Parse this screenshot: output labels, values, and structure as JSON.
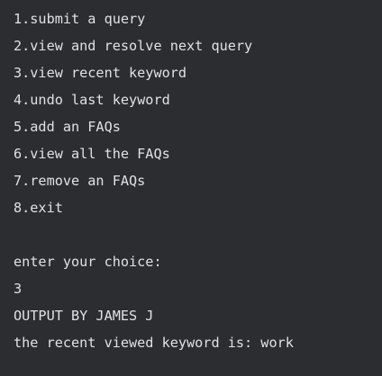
{
  "console": {
    "menu": [
      "1.submit a query",
      "2.view and resolve next query",
      "3.view recent keyword",
      "4.undo last keyword",
      "5.add an FAQs",
      "6.view all the FAQs",
      "7.remove an FAQs",
      "8.exit"
    ],
    "prompt": "enter your choice:",
    "user_input": "3",
    "output_header": "OUTPUT BY JAMES J",
    "result": "the recent viewed keyword is: work"
  }
}
